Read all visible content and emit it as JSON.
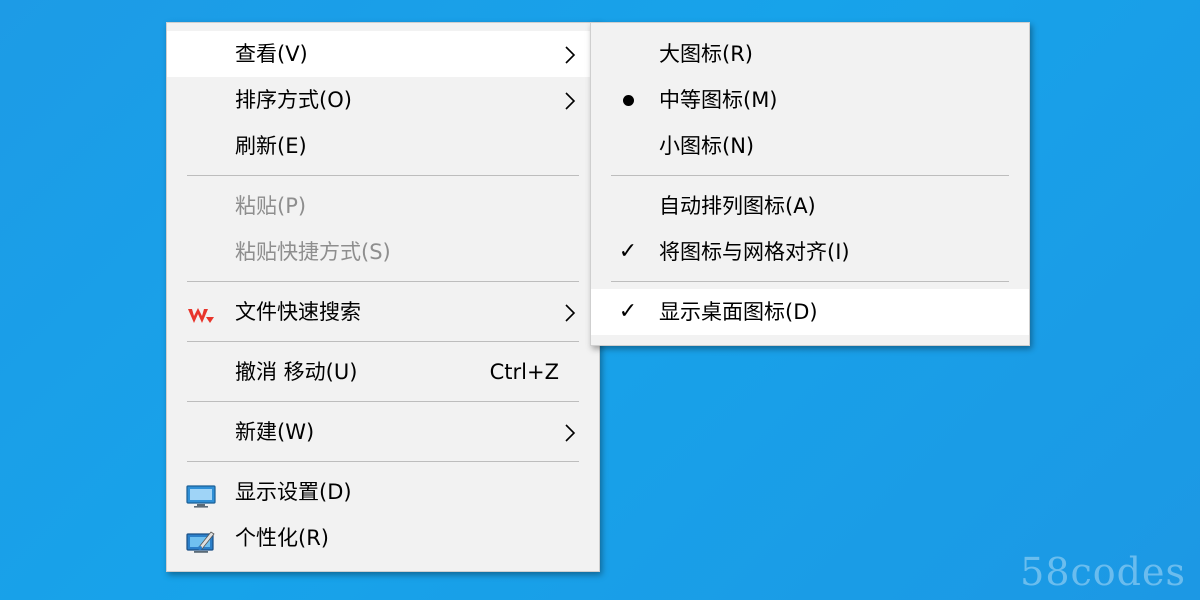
{
  "context_menu": {
    "view": "查看(V)",
    "sort": "排序方式(O)",
    "refresh": "刷新(E)",
    "paste": "粘贴(P)",
    "paste_shortcut": "粘贴快捷方式(S)",
    "file_search": "文件快速搜索",
    "undo": "撤消 移动(U)",
    "undo_shortcut": "Ctrl+Z",
    "new": "新建(W)",
    "display_settings": "显示设置(D)",
    "personalize": "个性化(R)",
    "arrow_glyph": "〉"
  },
  "view_submenu": {
    "large_icons": "大图标(R)",
    "medium_icons": "中等图标(M)",
    "small_icons": "小图标(N)",
    "auto_arrange": "自动排列图标(A)",
    "align_grid": "将图标与网格对齐(I)",
    "show_desktop_icons": "显示桌面图标(D)",
    "check_glyph": "✓",
    "selected": "medium_icons"
  },
  "watermark": "58codes",
  "colors": {
    "desktop": "#1aa0e8",
    "menu_bg": "#f2f2f2",
    "disabled_text": "#8e8e8e",
    "wps_red": "#e8352b"
  }
}
